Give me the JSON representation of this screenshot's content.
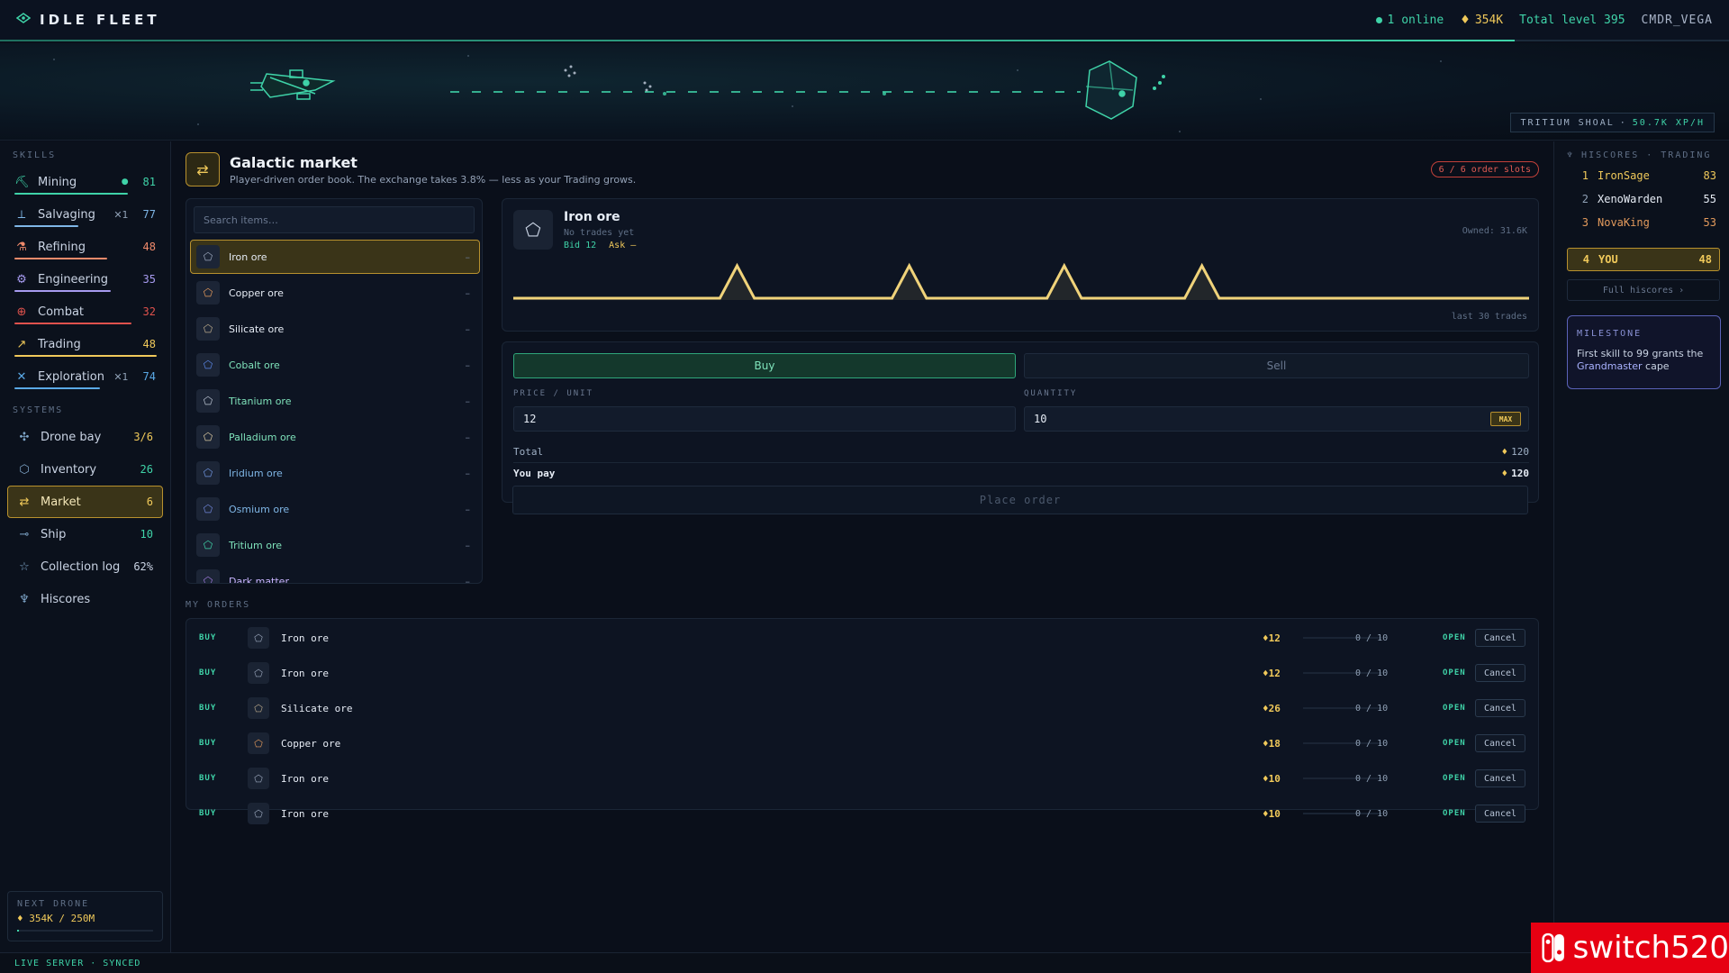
{
  "app": {
    "title": "IDLE FLEET",
    "online": "1 online",
    "credits": "354K",
    "total_level": "Total level 395",
    "user": "CMDR_VEGA",
    "xp_progress": 0.876
  },
  "hero": {
    "zone": "TRITIUM SHOAL",
    "separator": "·",
    "rate": "50.7K XP/H"
  },
  "sidebar": {
    "skills_title": "SKILLS",
    "skills": [
      {
        "name": "Mining",
        "level": "81",
        "icon": "pickaxe-icon",
        "color": "#3fd3a8",
        "progress": 0.8,
        "extra": "",
        "active_dot": true
      },
      {
        "name": "Salvaging",
        "level": "77",
        "icon": "salvage-icon",
        "color": "#7fb6e6",
        "progress": 0.45,
        "extra": "✕1",
        "active_dot": false
      },
      {
        "name": "Refining",
        "level": "48",
        "icon": "flask-icon",
        "color": "#f08a6b",
        "progress": 0.65,
        "extra": "",
        "active_dot": false
      },
      {
        "name": "Engineering",
        "level": "35",
        "icon": "cog-icon",
        "color": "#a79bf0",
        "progress": 0.68,
        "extra": "",
        "active_dot": false
      },
      {
        "name": "Combat",
        "level": "32",
        "icon": "crosshair-icon",
        "color": "#e0524d",
        "progress": 0.82,
        "extra": "",
        "active_dot": false
      },
      {
        "name": "Trading",
        "level": "48",
        "icon": "chart-icon",
        "color": "#f0c95a",
        "progress": 1.0,
        "extra": "",
        "active_dot": false
      },
      {
        "name": "Exploration",
        "level": "74",
        "icon": "compass-icon",
        "color": "#5aa9e6",
        "progress": 0.6,
        "extra": "✕1",
        "active_dot": false
      }
    ],
    "systems_title": "SYSTEMS",
    "systems": [
      {
        "name": "Drone bay",
        "value": "3/6",
        "icon": "drone-icon",
        "active": false,
        "value_color": "#f0c95a"
      },
      {
        "name": "Inventory",
        "value": "26",
        "icon": "box-icon",
        "active": false,
        "value_color": "#3fd3a8"
      },
      {
        "name": "Market",
        "value": "6",
        "icon": "exchange-icon",
        "active": true,
        "value_color": "#f0c95a"
      },
      {
        "name": "Ship",
        "value": "10",
        "icon": "ship-icon",
        "active": false,
        "value_color": "#3fd3a8"
      },
      {
        "name": "Collection log",
        "value": "62%",
        "icon": "star-icon",
        "active": false,
        "value_color": "#c9d3e3"
      },
      {
        "name": "Hiscores",
        "value": "",
        "icon": "trophy-icon",
        "active": false,
        "value_color": "#c9d3e3"
      }
    ],
    "next_drone": {
      "title": "NEXT DRONE",
      "value": "354K / 250M",
      "progress": 0.0014
    }
  },
  "status": "LIVE SERVER · SYNCED",
  "market": {
    "title": "Galactic market",
    "subtitle": "Player-driven order book. The exchange takes 3.8% — less as your Trading grows.",
    "slots": "6 / 6 order slots",
    "search_placeholder": "Search items…",
    "items": [
      {
        "name": "Iron ore",
        "value": "–",
        "color": "#e6ecf5",
        "icon_color": "#9aa6bb",
        "selected": true
      },
      {
        "name": "Copper ore",
        "value": "–",
        "color": "#e6ecf5",
        "icon_color": "#e39a5c",
        "selected": false
      },
      {
        "name": "Silicate ore",
        "value": "–",
        "color": "#e6ecf5",
        "icon_color": "#b9a88a",
        "selected": false
      },
      {
        "name": "Cobalt ore",
        "value": "–",
        "color": "#7fe3bb",
        "icon_color": "#5a86e6",
        "selected": false
      },
      {
        "name": "Titanium ore",
        "value": "–",
        "color": "#7fe3bb",
        "icon_color": "#b9c2d0",
        "selected": false
      },
      {
        "name": "Palladium ore",
        "value": "–",
        "color": "#7fe3bb",
        "icon_color": "#d9c8a0",
        "selected": false
      },
      {
        "name": "Iridium ore",
        "value": "–",
        "color": "#7fb6e6",
        "icon_color": "#6f95e0",
        "selected": false
      },
      {
        "name": "Osmium ore",
        "value": "–",
        "color": "#7fb6e6",
        "icon_color": "#6f85d8",
        "selected": false
      },
      {
        "name": "Tritium ore",
        "value": "–",
        "color": "#7fe3bb",
        "icon_color": "#3fd3a8",
        "selected": false
      },
      {
        "name": "Dark matter",
        "value": "–",
        "color": "#c9b5ff",
        "icon_color": "#a17be0",
        "selected": false
      }
    ],
    "detail": {
      "name": "Iron ore",
      "trades": "No trades yet",
      "bid": "Bid 12",
      "ask": "Ask –",
      "owned": "Owned: 31.6K",
      "caption": "last 30 trades",
      "spark_color": "#f0d37a",
      "spark": [
        0,
        0,
        0,
        0,
        0,
        0,
        0,
        0,
        0,
        0,
        0,
        0,
        0,
        1,
        0,
        0,
        0,
        0,
        0,
        0,
        0,
        0,
        0,
        1,
        0,
        0,
        0,
        0,
        0,
        0,
        0,
        0,
        1,
        0,
        0,
        0,
        0,
        0,
        0,
        0,
        1,
        0,
        0,
        0,
        0,
        0,
        0,
        0,
        0,
        0,
        0,
        0,
        0,
        0,
        0,
        0,
        0,
        0,
        0,
        0
      ]
    },
    "form": {
      "buy_label": "Buy",
      "sell_label": "Sell",
      "price_label": "PRICE / UNIT",
      "price_value": "12",
      "qty_label": "QUANTITY",
      "qty_value": "10",
      "max_label": "MAX",
      "total_label": "Total",
      "total_value": "120",
      "pay_label": "You pay",
      "pay_value": "120",
      "place_label": "Place order"
    },
    "orders_title": "MY ORDERS",
    "orders": [
      {
        "side": "BUY",
        "name": "Iron ore",
        "price": "12",
        "filled": "0 / 10",
        "status": "OPEN",
        "action": "Cancel",
        "icon_color": "#9aa6bb",
        "fill": 0
      },
      {
        "side": "BUY",
        "name": "Iron ore",
        "price": "12",
        "filled": "0 / 10",
        "status": "OPEN",
        "action": "Cancel",
        "icon_color": "#9aa6bb",
        "fill": 0
      },
      {
        "side": "BUY",
        "name": "Silicate ore",
        "price": "26",
        "filled": "0 / 10",
        "status": "OPEN",
        "action": "Cancel",
        "icon_color": "#b9a88a",
        "fill": 0
      },
      {
        "side": "BUY",
        "name": "Copper ore",
        "price": "18",
        "filled": "0 / 10",
        "status": "OPEN",
        "action": "Cancel",
        "icon_color": "#e39a5c",
        "fill": 0
      },
      {
        "side": "BUY",
        "name": "Iron ore",
        "price": "10",
        "filled": "0 / 10",
        "status": "OPEN",
        "action": "Cancel",
        "icon_color": "#9aa6bb",
        "fill": 0
      },
      {
        "side": "BUY",
        "name": "Iron ore",
        "price": "10",
        "filled": "0 / 10",
        "status": "OPEN",
        "action": "Cancel",
        "icon_color": "#9aa6bb",
        "fill": 0
      }
    ]
  },
  "hiscores": {
    "title": "HISCORES · TRADING",
    "rows": [
      {
        "rank": "1",
        "name": "IronSage",
        "level": "83"
      },
      {
        "rank": "2",
        "name": "XenoWarden",
        "level": "55"
      },
      {
        "rank": "3",
        "name": "NovaKing",
        "level": "53"
      }
    ],
    "you": {
      "rank": "4",
      "name": "YOU",
      "level": "48"
    },
    "full_label": "Full hiscores ›",
    "milestone_title": "MILESTONE",
    "milestone_text": "First skill to 99 grants the",
    "milestone_highlight": "Grandmaster",
    "milestone_tail": "cape"
  },
  "watermark": "switch520"
}
